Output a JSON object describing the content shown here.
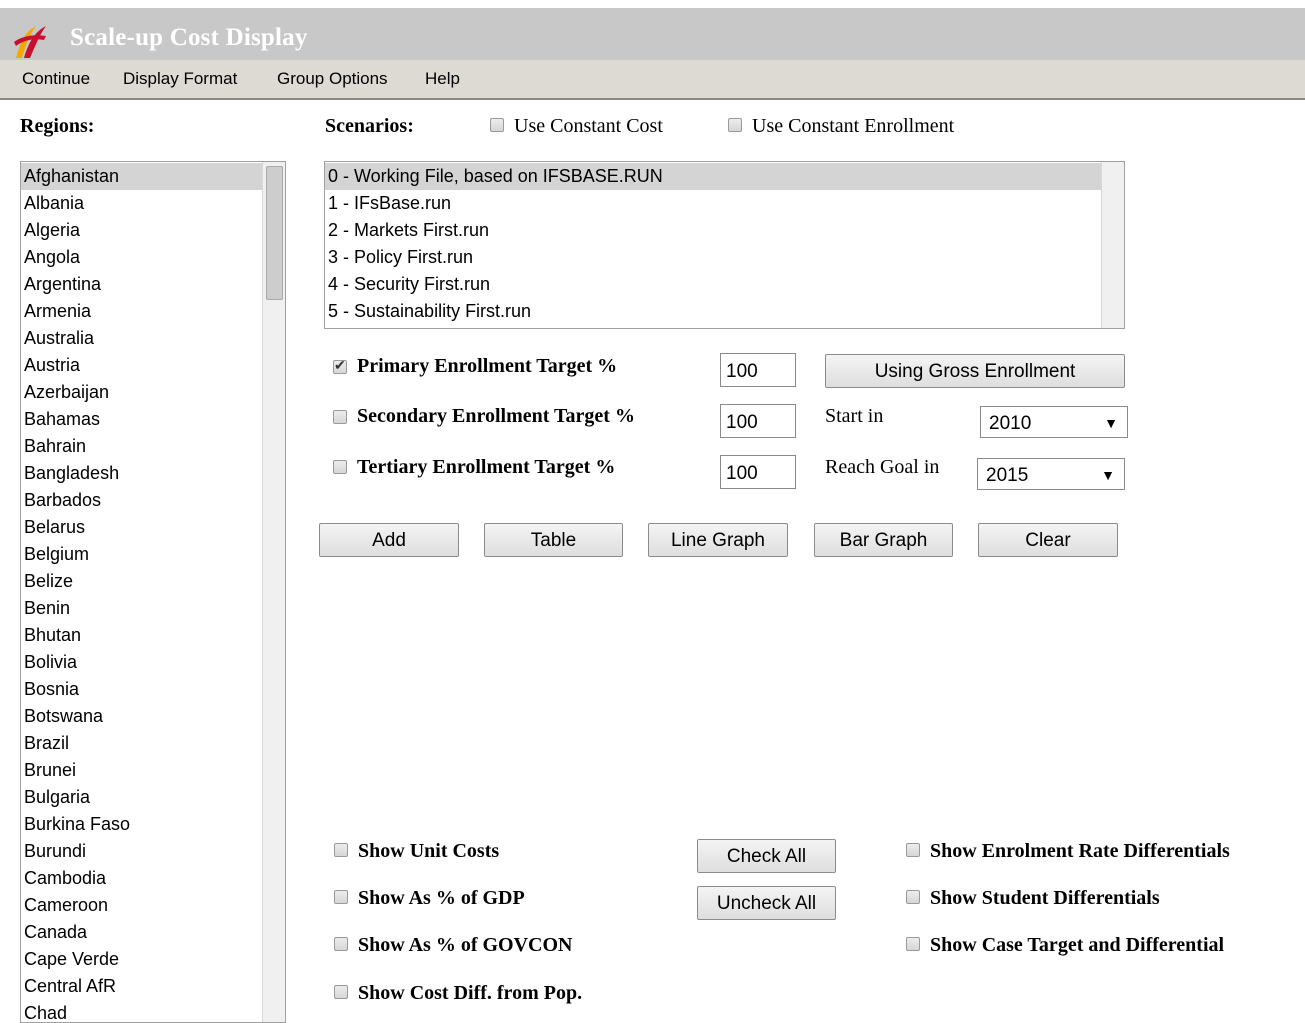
{
  "window": {
    "title": "Scale-up Cost Display",
    "logo_icon": "ifs-logo-icon"
  },
  "menu": [
    "Continue",
    "Display Format",
    "Group Options",
    "Help"
  ],
  "regions": {
    "label": "Regions:",
    "selected": "Afghanistan",
    "items": [
      "Afghanistan",
      "Albania",
      "Algeria",
      "Angola",
      "Argentina",
      "Armenia",
      "Australia",
      "Austria",
      "Azerbaijan",
      "Bahamas",
      "Bahrain",
      "Bangladesh",
      "Barbados",
      "Belarus",
      "Belgium",
      "Belize",
      "Benin",
      "Bhutan",
      "Bolivia",
      "Bosnia",
      "Botswana",
      "Brazil",
      "Brunei",
      "Bulgaria",
      "Burkina Faso",
      "Burundi",
      "Cambodia",
      "Cameroon",
      "Canada",
      "Cape Verde",
      "Central AfR",
      "Chad"
    ]
  },
  "scenarios": {
    "label": "Scenarios:",
    "use_constant_cost": {
      "label": "Use Constant Cost",
      "checked": false
    },
    "use_constant_enrollment": {
      "label": "Use Constant Enrollment",
      "checked": false
    },
    "selected": "0 - Working File, based on IFSBASE.RUN",
    "items": [
      "0 - Working File, based on IFSBASE.RUN",
      "1 - IFsBase.run",
      "2 - Markets First.run",
      "3 - Policy First.run",
      "4 - Security First.run",
      "5 - Sustainability First.run"
    ]
  },
  "targets": {
    "primary": {
      "label": "Primary Enrollment Target %",
      "checked": true,
      "value": "100"
    },
    "secondary": {
      "label": "Secondary Enrollment Target %",
      "checked": false,
      "value": "100"
    },
    "tertiary": {
      "label": "Tertiary Enrollment Target %",
      "checked": false,
      "value": "100"
    },
    "gross_button": "Using Gross Enrollment",
    "start_label": "Start in",
    "start_value": "2010",
    "reach_label": "Reach Goal in",
    "reach_value": "2015"
  },
  "actions": [
    "Add",
    "Table",
    "Line Graph",
    "Bar Graph",
    "Clear"
  ],
  "options": {
    "unit_costs": "Show Unit Costs",
    "pct_gdp": "Show As % of GDP",
    "pct_govcon": "Show As % of GOVCON",
    "cost_diff_pop": "Show Cost Diff. from Pop.",
    "check_all": "Check All",
    "uncheck_all": "Uncheck All",
    "enrolment_rate_diff": "Show Enrolment Rate Differentials",
    "student_diff": "Show Student Differentials",
    "case_target_diff": "Show Case Target and Differential"
  },
  "colors": {
    "logo_red": "#c8102e",
    "logo_yellow": "#f2a900",
    "titlebar": "#c8c8c8",
    "menubar": "#ddd9d3",
    "selection": "#d4d4d4"
  }
}
